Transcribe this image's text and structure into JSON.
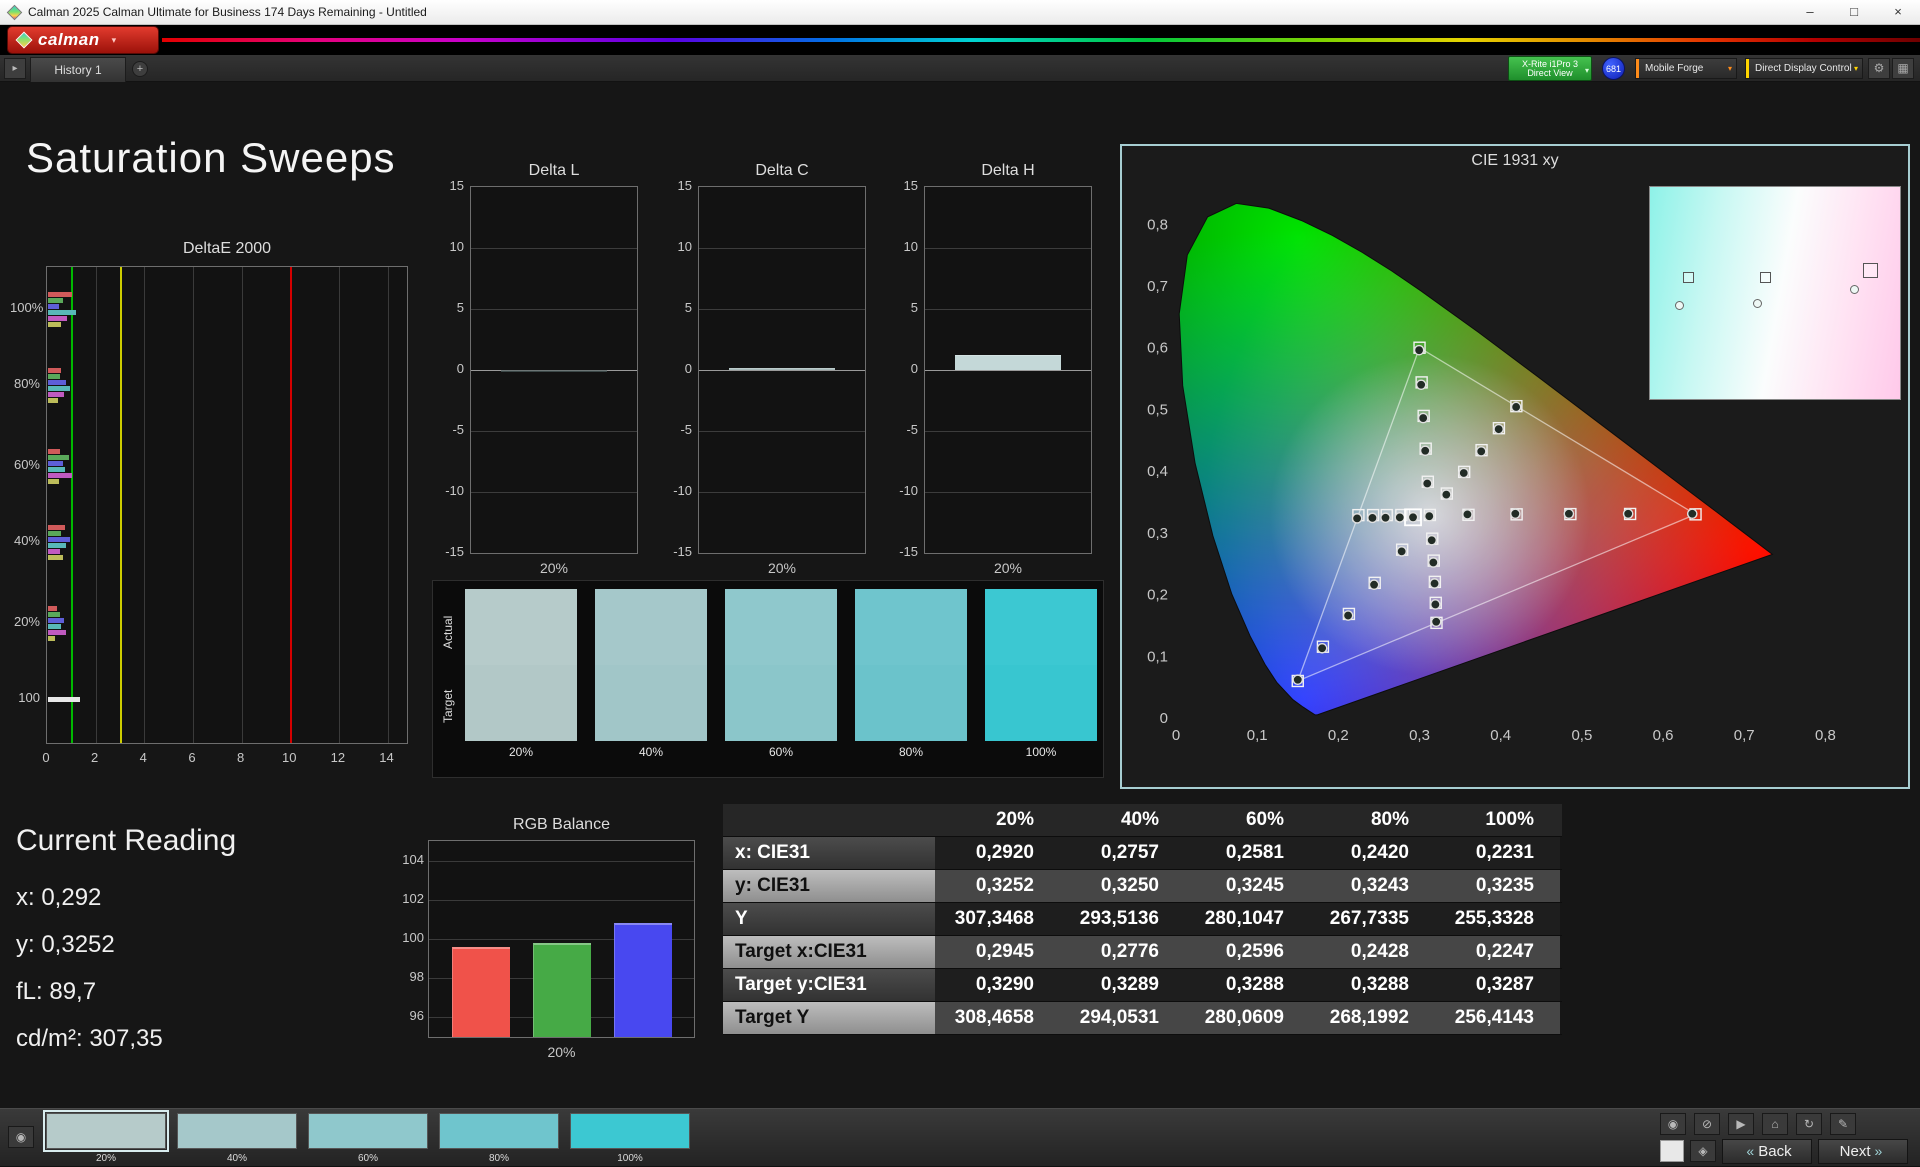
{
  "window": {
    "title": "Calman 2025 Calman Ultimate for Business 174 Days Remaining  - Untitled",
    "minimize": "–",
    "maximize": "□",
    "close": "×"
  },
  "header": {
    "logo": "calman"
  },
  "icons": {
    "caret": "▾",
    "panel_toggle": "▸",
    "gear": "⚙",
    "display": "▦",
    "eye": "◉",
    "back_icon": "«",
    "next_icon": "»",
    "meter_view": "◈"
  },
  "toolbar": {
    "history_tab": "History 1",
    "add_tab": "+",
    "meter": {
      "line1": "X-Rite i1Pro 3",
      "line2": "Direct View"
    },
    "badge": "681",
    "source_dropdown": "Mobile Forge",
    "control_dropdown": "Direct Display Control",
    "source_accent": "#ff8c1a",
    "control_accent": "#ffd400"
  },
  "page_title": "Saturation Sweeps",
  "current_reading": {
    "title": "Current Reading",
    "x": "x: 0,292",
    "y": "y: 0,3252",
    "fl": "fL: 89,7",
    "cdm2": "cd/m²: 307,35"
  },
  "swatch_panel": {
    "actual": "Actual",
    "target": "Target",
    "items": [
      {
        "label": "20%",
        "actual": "#b6cbca",
        "target": "#b2c8c7"
      },
      {
        "label": "40%",
        "actual": "#a5c8ca",
        "target": "#a1c6c8"
      },
      {
        "label": "60%",
        "actual": "#8fc8cc",
        "target": "#8bc6ca"
      },
      {
        "label": "80%",
        "actual": "#6fc5cd",
        "target": "#6bc3cb"
      },
      {
        "label": "100%",
        "actual": "#3cc8d2",
        "target": "#38c6d0"
      }
    ]
  },
  "bottombar": {
    "back": "Back",
    "next": "Next",
    "selected": 0,
    "thumbs": [
      {
        "label": "20%",
        "color": "#b6cbca"
      },
      {
        "label": "40%",
        "color": "#a5c8ca"
      },
      {
        "label": "60%",
        "color": "#8fc8cc"
      },
      {
        "label": "80%",
        "color": "#6fc5cd"
      },
      {
        "label": "100%",
        "color": "#3cc8d2"
      }
    ],
    "top_icons": [
      {
        "name": "eye",
        "glyph": "◉"
      },
      {
        "name": "trash",
        "glyph": "⊘"
      },
      {
        "name": "play",
        "glyph": "▶"
      },
      {
        "name": "home",
        "glyph": "⌂"
      },
      {
        "name": "refresh",
        "glyph": "↻"
      },
      {
        "name": "edit",
        "glyph": "✎"
      }
    ]
  },
  "chart_data": [
    {
      "id": "deltae",
      "type": "bar",
      "title": "DeltaE 2000",
      "xticks": [
        0,
        2,
        4,
        6,
        8,
        10,
        12,
        14
      ],
      "xmax": 14.8,
      "ref_lines": [
        {
          "value": 1,
          "color": "#00b800"
        },
        {
          "value": 3,
          "color": "#cdcd00"
        },
        {
          "value": 10,
          "color": "#d40000"
        }
      ],
      "bar_colors": [
        "#d05a5a",
        "#5aa85a",
        "#5e5ed8",
        "#58b8b8",
        "#c05ac0",
        "#bcbc5a"
      ],
      "groups": [
        {
          "label": "100%",
          "values": [
            1.0,
            0.6,
            0.45,
            1.15,
            0.8,
            0.55
          ]
        },
        {
          "label": "80%",
          "values": [
            0.55,
            0.5,
            0.75,
            0.9,
            0.65,
            0.4
          ]
        },
        {
          "label": "60%",
          "values": [
            0.5,
            0.85,
            0.6,
            0.7,
            1.0,
            0.45
          ]
        },
        {
          "label": "40%",
          "values": [
            0.7,
            0.55,
            0.9,
            0.75,
            0.5,
            0.6
          ]
        },
        {
          "label": "20%",
          "values": [
            0.35,
            0.5,
            0.65,
            0.55,
            0.75,
            0.3
          ]
        },
        {
          "label": "100",
          "values": [
            1.3
          ],
          "colors": [
            "#e8e8e8"
          ]
        }
      ]
    },
    {
      "id": "deltaL",
      "type": "bar",
      "title": "Delta L",
      "ymin": -15,
      "ymax": 15,
      "ystep": 5,
      "xlabel": "20%",
      "value": -0.2,
      "color": "#3c4848"
    },
    {
      "id": "deltaC",
      "type": "bar",
      "title": "Delta C",
      "ymin": -15,
      "ymax": 15,
      "ystep": 5,
      "xlabel": "20%",
      "value": 0.2,
      "color": "#a6baba"
    },
    {
      "id": "deltaH",
      "type": "bar",
      "title": "Delta H",
      "ymin": -15,
      "ymax": 15,
      "ystep": 5,
      "xlabel": "20%",
      "value": 1.2,
      "color": "#c4d8d8"
    },
    {
      "id": "cie",
      "type": "scatter",
      "title": "CIE 1931 xy",
      "xlim": [
        0,
        0.85
      ],
      "ylim": [
        0,
        0.875
      ],
      "xtick_labels": [
        "0",
        "0,1",
        "0,2",
        "0,3",
        "0,4",
        "0,5",
        "0,6",
        "0,7",
        "0,8"
      ],
      "ytick_labels": [
        "0",
        "0,1",
        "0,2",
        "0,3",
        "0,4",
        "0,5",
        "0,6",
        "0,7",
        "0,8"
      ],
      "gamut_triangle": [
        [
          0.64,
          0.33
        ],
        [
          0.3,
          0.6
        ],
        [
          0.15,
          0.06
        ]
      ],
      "white_point": [
        0.3127,
        0.329
      ],
      "highlight_point": [
        0.292,
        0.3252
      ],
      "target_points": [
        [
          0.3127,
          0.329
        ],
        [
          0.2945,
          0.329
        ],
        [
          0.2776,
          0.3289
        ],
        [
          0.2596,
          0.3288
        ],
        [
          0.2428,
          0.3288
        ],
        [
          0.2247,
          0.3287
        ],
        [
          0.3603,
          0.3292
        ],
        [
          0.4196,
          0.33
        ],
        [
          0.4858,
          0.3304
        ],
        [
          0.5594,
          0.3306
        ],
        [
          0.64,
          0.33
        ],
        [
          0.3102,
          0.3828
        ],
        [
          0.3076,
          0.4364
        ],
        [
          0.3051,
          0.4895
        ],
        [
          0.3026,
          0.5438
        ],
        [
          0.3,
          0.6
        ],
        [
          0.2786,
          0.2727
        ],
        [
          0.2448,
          0.219
        ],
        [
          0.213,
          0.1686
        ],
        [
          0.181,
          0.1155
        ],
        [
          0.15,
          0.06
        ],
        [
          0.3157,
          0.2906
        ],
        [
          0.3175,
          0.255
        ],
        [
          0.3189,
          0.2206
        ],
        [
          0.32,
          0.1866
        ],
        [
          0.3209,
          0.1542
        ],
        [
          0.3336,
          0.3637
        ],
        [
          0.355,
          0.3988
        ],
        [
          0.3764,
          0.434
        ],
        [
          0.3978,
          0.4696
        ],
        [
          0.4193,
          0.5053
        ]
      ],
      "measured_points": [
        [
          0.312,
          0.327
        ],
        [
          0.292,
          0.3252
        ],
        [
          0.2757,
          0.325
        ],
        [
          0.2581,
          0.3245
        ],
        [
          0.242,
          0.3243
        ],
        [
          0.2231,
          0.3235
        ],
        [
          0.359,
          0.33
        ],
        [
          0.418,
          0.331
        ],
        [
          0.484,
          0.331
        ],
        [
          0.557,
          0.331
        ],
        [
          0.636,
          0.331
        ],
        [
          0.3095,
          0.38
        ],
        [
          0.307,
          0.433
        ],
        [
          0.3045,
          0.486
        ],
        [
          0.302,
          0.54
        ],
        [
          0.2995,
          0.596
        ],
        [
          0.278,
          0.27
        ],
        [
          0.244,
          0.216
        ],
        [
          0.212,
          0.166
        ],
        [
          0.18,
          0.113
        ],
        [
          0.15,
          0.062
        ],
        [
          0.315,
          0.288
        ],
        [
          0.317,
          0.252
        ],
        [
          0.3185,
          0.218
        ],
        [
          0.3195,
          0.184
        ],
        [
          0.3205,
          0.156
        ],
        [
          0.333,
          0.362
        ],
        [
          0.3545,
          0.397
        ],
        [
          0.376,
          0.432
        ],
        [
          0.3975,
          0.468
        ],
        [
          0.419,
          0.504
        ]
      ],
      "inset": {
        "markers": [
          {
            "t": "s",
            "x": 0.13,
            "y": 0.4
          },
          {
            "t": "c",
            "x": 0.1,
            "y": 0.54
          },
          {
            "t": "s",
            "x": 0.44,
            "y": 0.4
          },
          {
            "t": "c",
            "x": 0.41,
            "y": 0.53
          },
          {
            "t": "s",
            "x": 0.85,
            "y": 0.36,
            "big": true
          },
          {
            "t": "c",
            "x": 0.8,
            "y": 0.46
          }
        ]
      }
    },
    {
      "id": "rgb",
      "type": "bar",
      "title": "RGB Balance",
      "ymin": 95,
      "ymax": 105,
      "yticks": [
        96,
        98,
        100,
        102,
        104
      ],
      "xlabel": "20%",
      "series": [
        {
          "name": "Red",
          "value": 99.6,
          "color": "#f0524a"
        },
        {
          "name": "Green",
          "value": 99.8,
          "color": "#46aa46"
        },
        {
          "name": "Blue",
          "value": 100.8,
          "color": "#4848f0"
        }
      ]
    },
    {
      "id": "sweep-table",
      "type": "table",
      "columns": [
        "",
        "20%",
        "40%",
        "60%",
        "80%",
        "100%"
      ],
      "rows": [
        {
          "label": "x: CIE31",
          "values": [
            "0,2920",
            "0,2757",
            "0,2581",
            "0,2420",
            "0,2231"
          ]
        },
        {
          "label": "y: CIE31",
          "values": [
            "0,3252",
            "0,3250",
            "0,3245",
            "0,3243",
            "0,3235"
          ]
        },
        {
          "label": "Y",
          "values": [
            "307,3468",
            "293,5136",
            "280,1047",
            "267,7335",
            "255,3328"
          ]
        },
        {
          "label": "Target x:CIE31",
          "values": [
            "0,2945",
            "0,2776",
            "0,2596",
            "0,2428",
            "0,2247"
          ]
        },
        {
          "label": "Target y:CIE31",
          "values": [
            "0,3290",
            "0,3289",
            "0,3288",
            "0,3288",
            "0,3287"
          ]
        },
        {
          "label": "Target Y",
          "values": [
            "308,4658",
            "294,0531",
            "280,0609",
            "268,1992",
            "256,4143"
          ]
        }
      ]
    }
  ]
}
